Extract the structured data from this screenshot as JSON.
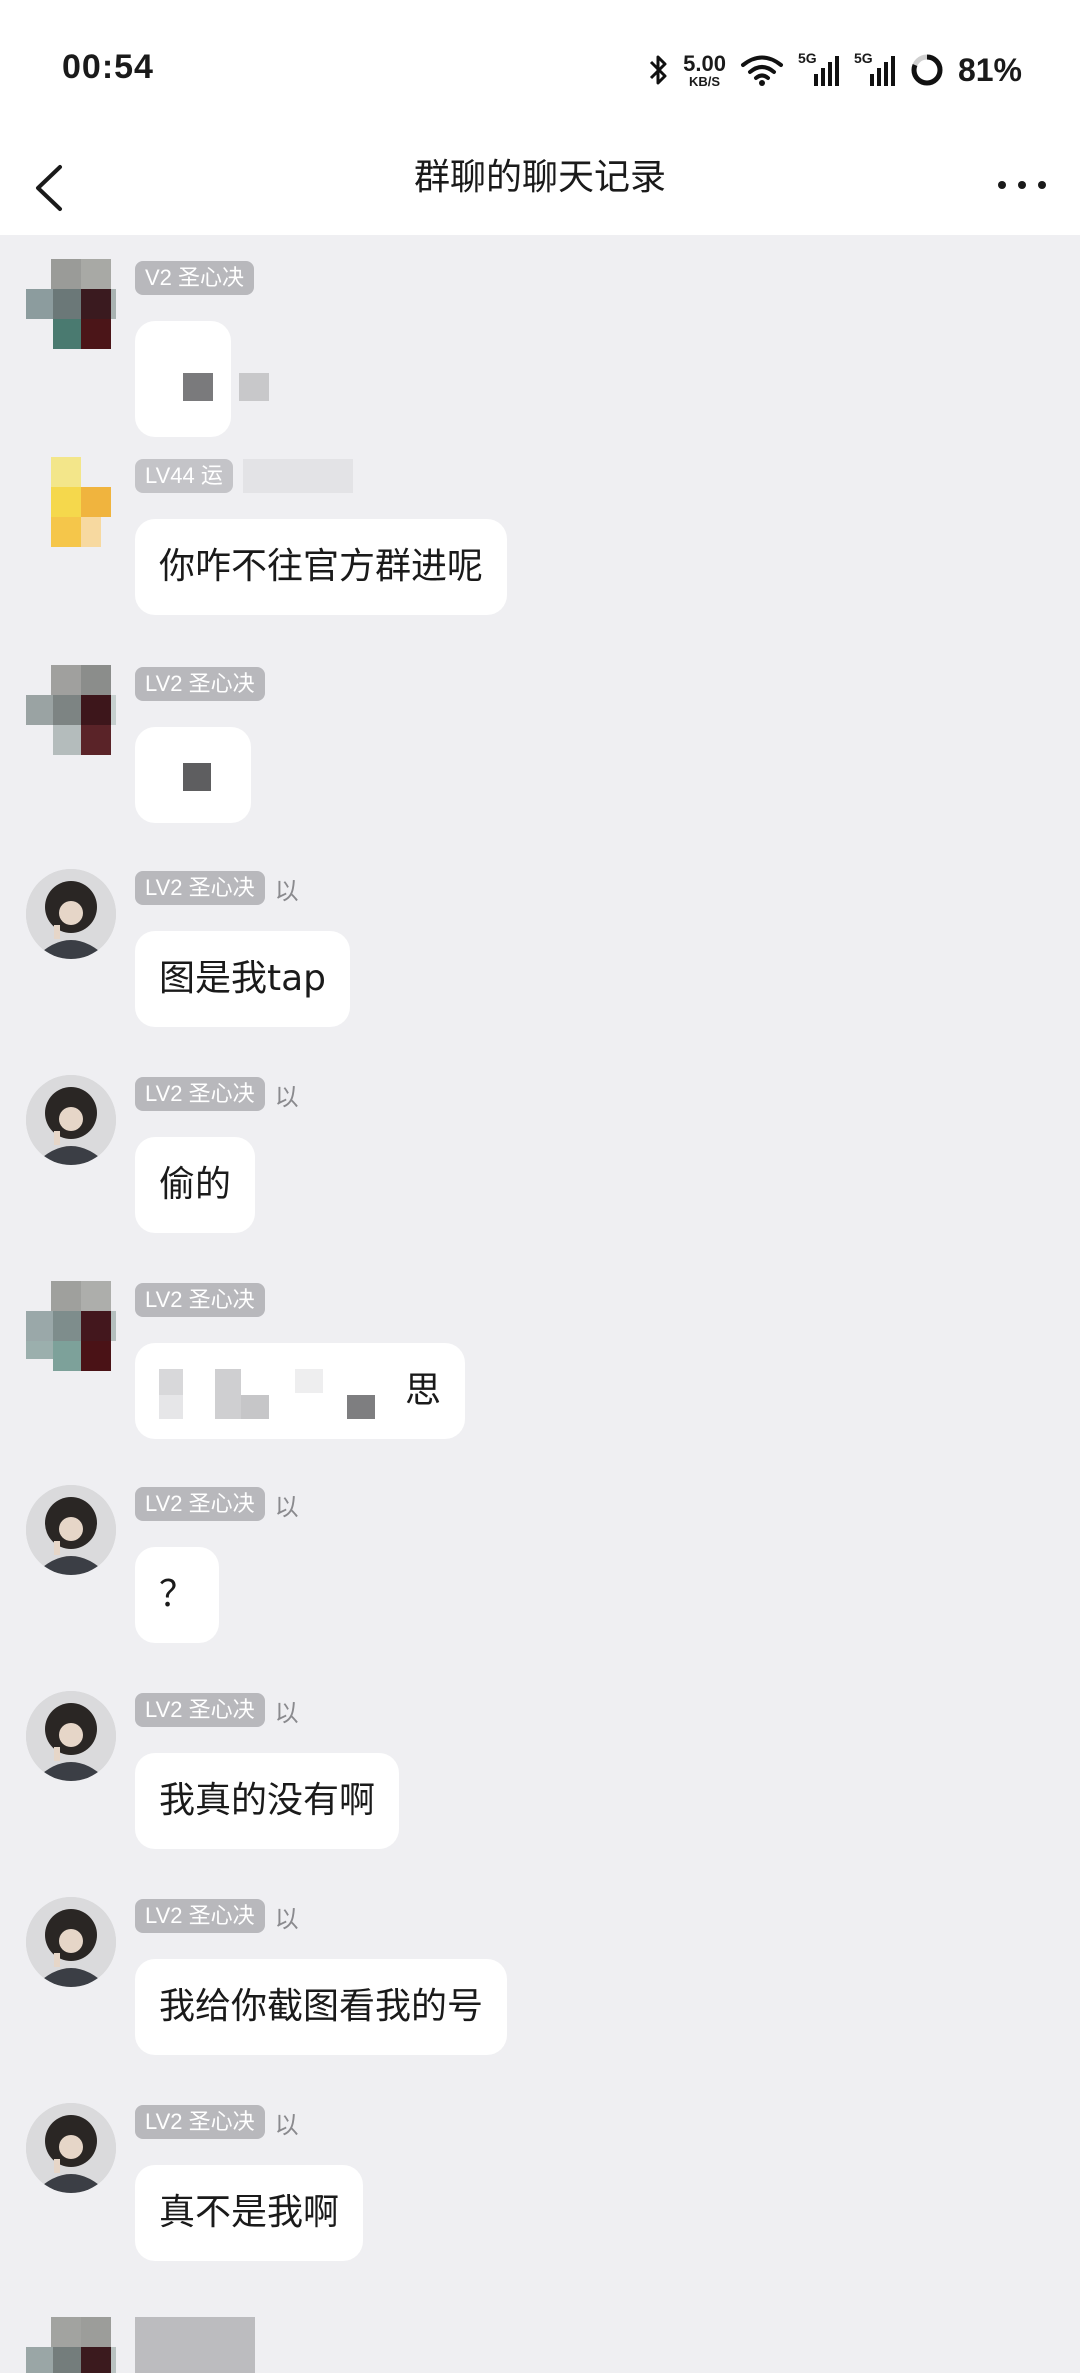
{
  "status_bar": {
    "time": "00:54",
    "net_speed_value": "5.00",
    "net_speed_unit": "KB/S",
    "sim1": "5G",
    "sim2": "5G",
    "battery": "81%"
  },
  "nav": {
    "title": "群聊的聊天记录",
    "back_icon": "chevron-left-icon",
    "more_icon": "more-dots-icon"
  },
  "messages": [
    {
      "badge": "V2 圣心决",
      "suffix": "",
      "text": "",
      "avatar": "mosaic"
    },
    {
      "badge": "LV44 运",
      "suffix": "",
      "text": "你咋不往官方群进呢",
      "avatar": "mosaic-yellow"
    },
    {
      "badge": "LV2 圣心决",
      "suffix": "",
      "text": "",
      "avatar": "mosaic"
    },
    {
      "badge": "LV2 圣心决",
      "suffix": "以",
      "text": "图是我tap",
      "avatar": "photo"
    },
    {
      "badge": "LV2 圣心决",
      "suffix": "以",
      "text": "偷的",
      "avatar": "photo"
    },
    {
      "badge": "LV2 圣心决",
      "suffix": "",
      "text": "思",
      "avatar": "mosaic"
    },
    {
      "badge": "LV2 圣心决",
      "suffix": "以",
      "text": "？",
      "avatar": "photo"
    },
    {
      "badge": "LV2 圣心决",
      "suffix": "以",
      "text": "我真的没有啊",
      "avatar": "photo"
    },
    {
      "badge": "LV2 圣心决",
      "suffix": "以",
      "text": "我给你截图看我的号",
      "avatar": "photo"
    },
    {
      "badge": "LV2 圣心决",
      "suffix": "以",
      "text": "真不是我啊",
      "avatar": "photo"
    }
  ]
}
